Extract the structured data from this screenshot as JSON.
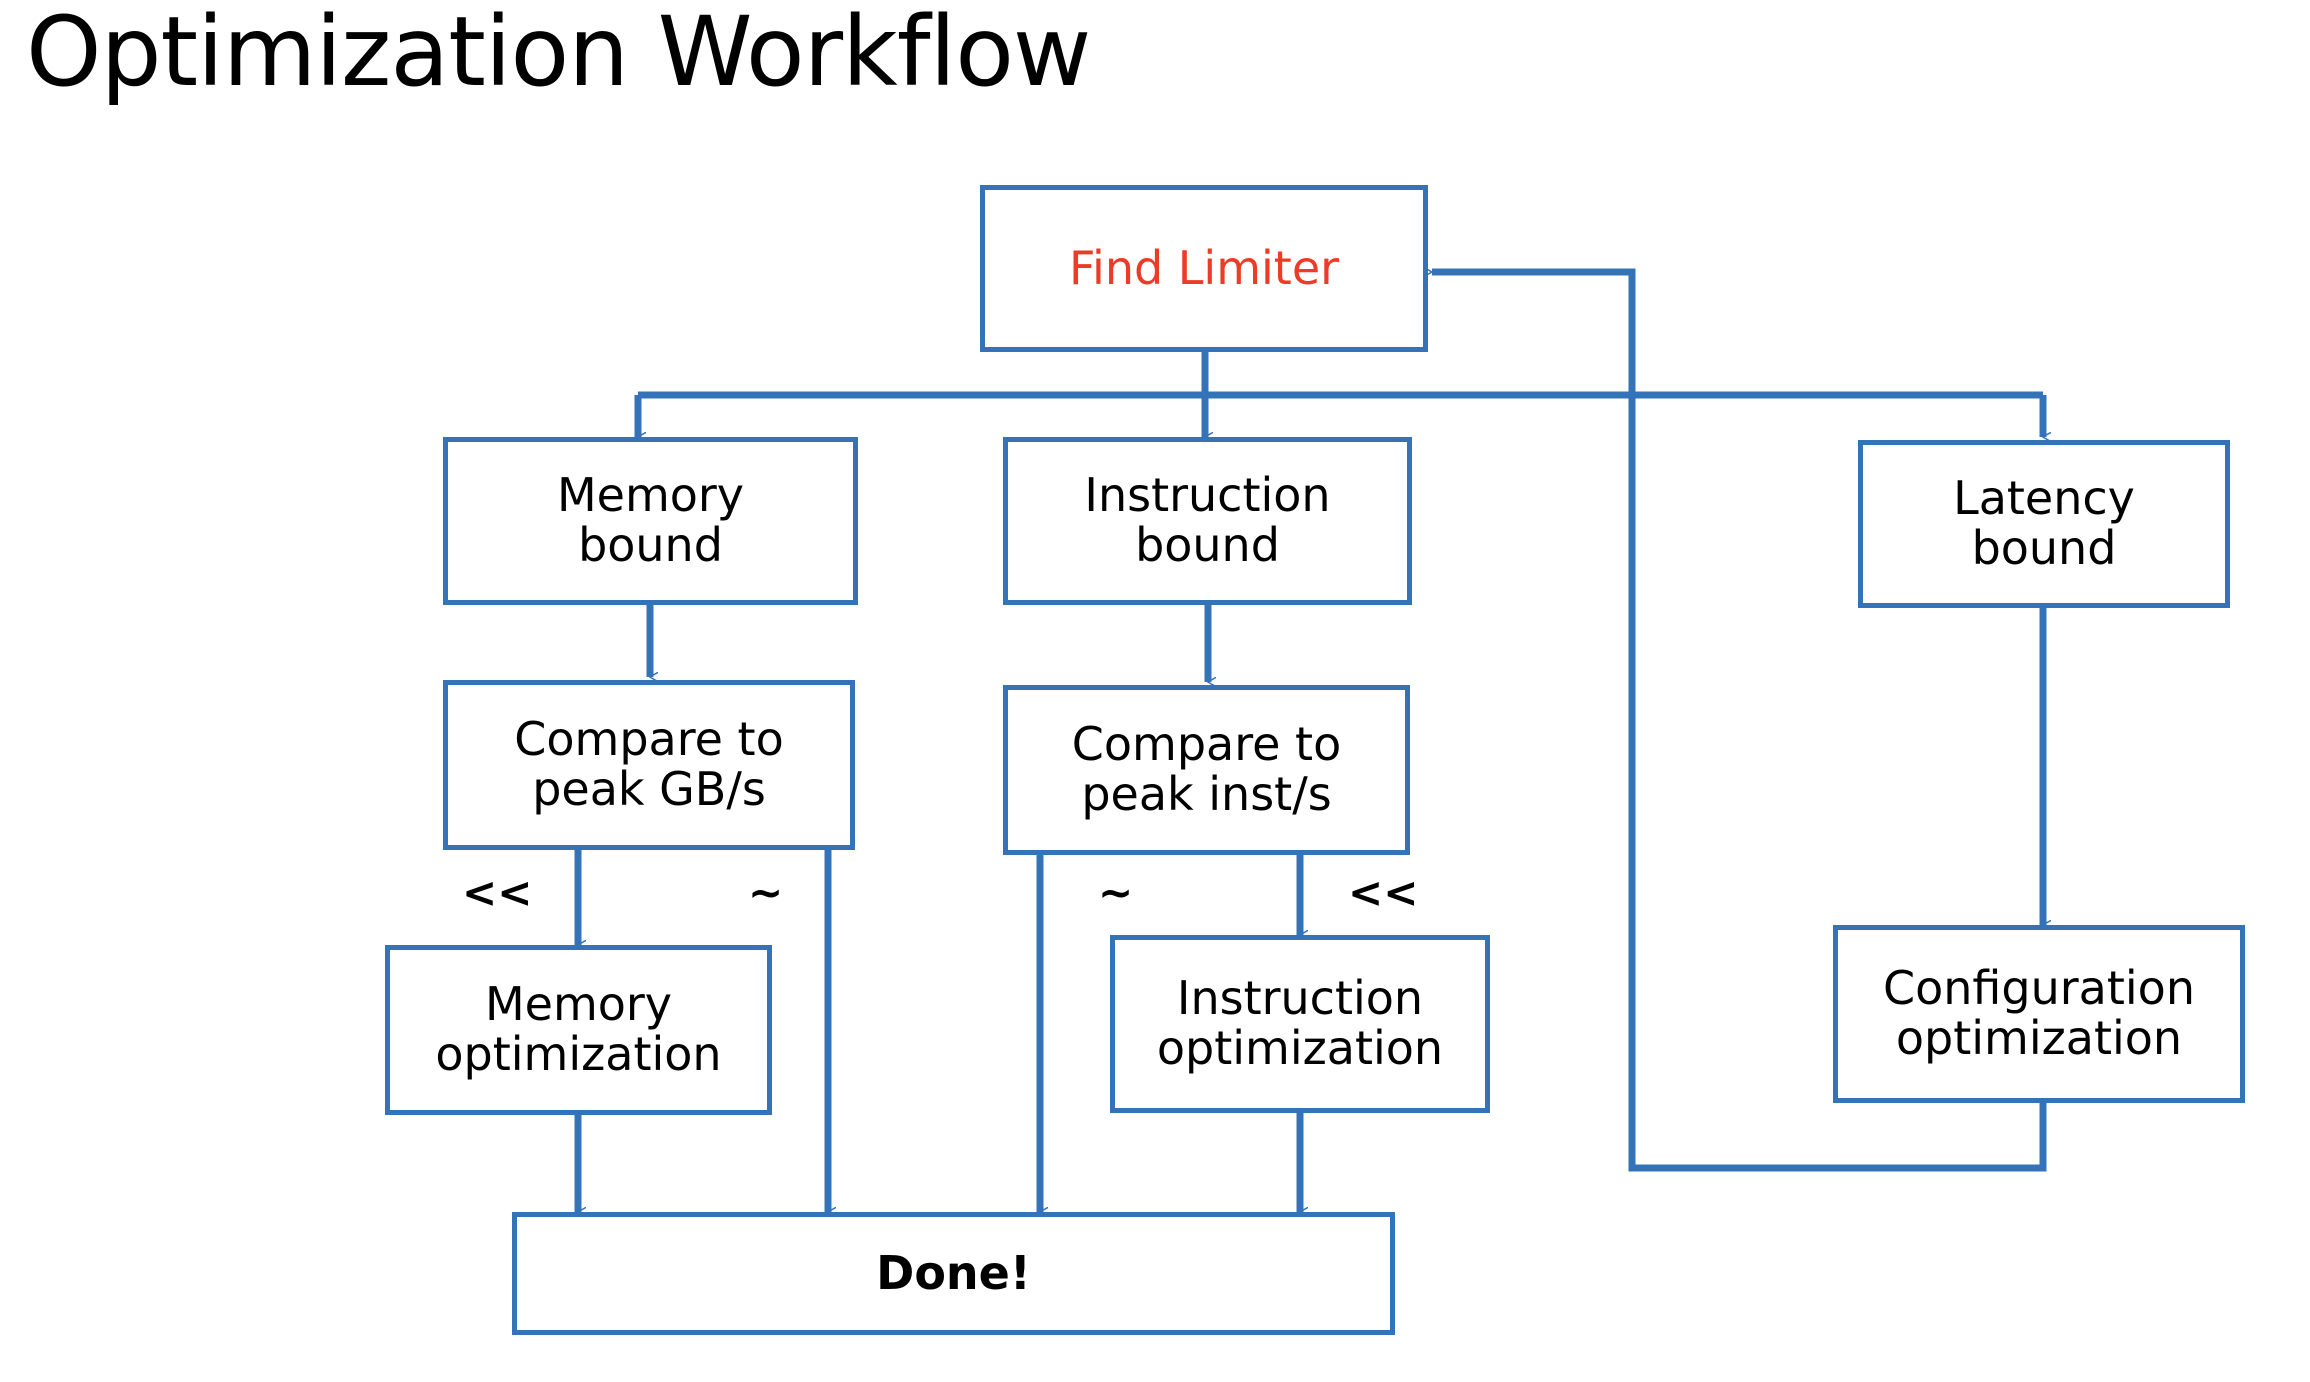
{
  "page": {
    "title": "Optimization Workflow",
    "background_color": "#ffffff",
    "edge_color": "#3573b9",
    "accent_text_color": "#ec3b26",
    "text_color": "#000000"
  },
  "nodes": {
    "find_limiter": "Find Limiter",
    "memory_bound": "Memory\nbound",
    "instruction_bound": "Instruction\nbound",
    "latency_bound": "Latency\nbound",
    "compare_gbs": "Compare to\npeak GB/s",
    "compare_insts": "Compare to\npeak inst/s",
    "memory_optimization": "Memory\noptimization",
    "instruction_optimization": "Instruction\noptimization",
    "configuration_optimization": "Configuration\noptimization",
    "done": "Done!"
  },
  "edge_labels": {
    "memory_much_less": "<<",
    "memory_approx": "~",
    "instruction_approx": "~",
    "instruction_much_less": "<<"
  }
}
